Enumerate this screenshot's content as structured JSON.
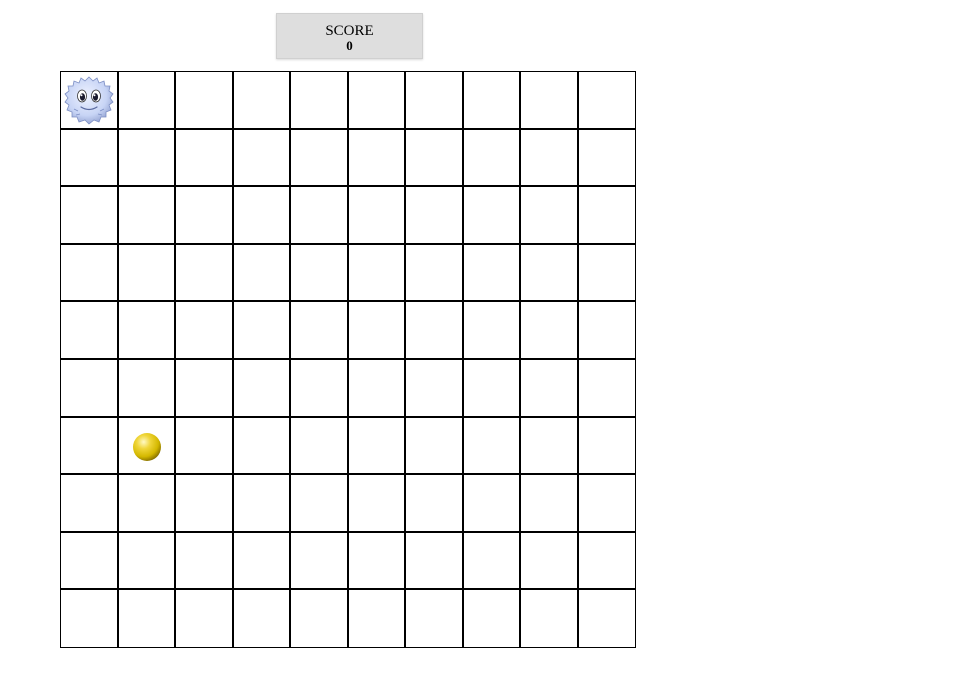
{
  "score": {
    "label": "SCORE",
    "value": "0"
  },
  "board": {
    "rows": 10,
    "cols": 10,
    "player": {
      "row": 0,
      "col": 0,
      "icon": "fluffy-creature-icon"
    },
    "coin": {
      "row": 6,
      "col": 1,
      "icon": "gold-ball-icon"
    }
  },
  "colors": {
    "grid_line": "#000000",
    "score_bg": "#dedede",
    "coin": "#d4b800",
    "player": "#c7d4f5"
  }
}
